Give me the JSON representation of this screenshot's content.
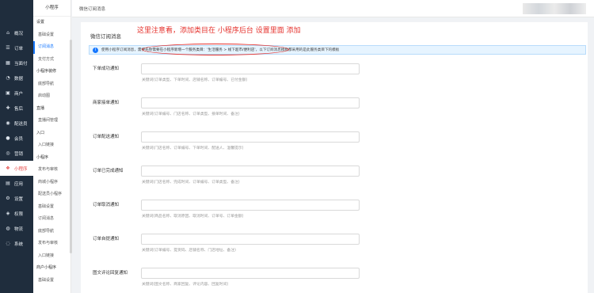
{
  "nav": {
    "items": [
      {
        "label": "概况",
        "icon": "home-icon"
      },
      {
        "label": "订单",
        "icon": "list-icon"
      },
      {
        "label": "当面付",
        "icon": "qr-icon"
      },
      {
        "label": "数据",
        "icon": "chart-icon"
      },
      {
        "label": "商户",
        "icon": "store-icon"
      },
      {
        "label": "售后",
        "icon": "service-icon"
      },
      {
        "label": "配送员",
        "icon": "courier-icon"
      },
      {
        "label": "会员",
        "icon": "user-icon"
      },
      {
        "label": "营销",
        "icon": "marketing-icon"
      },
      {
        "label": "小程序",
        "icon": "app-icon"
      },
      {
        "label": "应用",
        "icon": "grid-icon"
      },
      {
        "label": "设置",
        "icon": "gear-icon"
      },
      {
        "label": "权限",
        "icon": "lock-icon"
      },
      {
        "label": "物流",
        "icon": "truck-icon"
      },
      {
        "label": "系统",
        "icon": "system-icon"
      }
    ],
    "active_index": 9
  },
  "submenu": {
    "title": "小程序",
    "items": [
      {
        "label": "设置",
        "group": true
      },
      {
        "label": "基础设置"
      },
      {
        "label": "订阅消息",
        "active": true
      },
      {
        "label": "支付方式"
      },
      {
        "label": "小程序装修",
        "group": true
      },
      {
        "label": "底部导航"
      },
      {
        "label": "启动图"
      },
      {
        "label": "直播",
        "group": true
      },
      {
        "label": "直播间管理"
      },
      {
        "label": "入口",
        "group": true
      },
      {
        "label": "入口链接"
      },
      {
        "label": "小程序",
        "group": true
      },
      {
        "label": "发布与审核"
      },
      {
        "label": "商城小程序"
      },
      {
        "label": "配送员小程序"
      },
      {
        "label": "基础设置"
      },
      {
        "label": "订阅消息"
      },
      {
        "label": "底部导航"
      },
      {
        "label": "发布与审核"
      },
      {
        "label": "入口链接"
      },
      {
        "label": "商户小程序",
        "group": true
      },
      {
        "label": "基础设置"
      }
    ]
  },
  "topbar": {
    "breadcrumb": "微信订阅消息"
  },
  "card": {
    "title": "微信订阅消息"
  },
  "annotation": "这里注意看，添加类目在 小程序后台 设置里面 添加",
  "notice": {
    "prefix": "使用小程序订阅消息",
    "highlight": "需要先你需要在小程序新增一个服务类目：'生活服务 > 线下超市/便利店'",
    "suffix": "以下订阅消息模板都采用的是此服务类目下的模板"
  },
  "rows": [
    {
      "label": "下单成功通知",
      "hint": "关键词(订单类型、下单时间、店铺名称、订单编号、已付金额)"
    },
    {
      "label": "商家接单通知",
      "hint": "关键词(订单编号、门店名称、订单类型、接单时间、备注)"
    },
    {
      "label": "订单配送通知",
      "hint": "关键词(门店名称、订单编号、下单时间、配送人、温馨提示)"
    },
    {
      "label": "订单已完成通知",
      "hint": "关键词(门店名称、完成时间、订单编号、订单类型、备注)"
    },
    {
      "label": "订单取消通知",
      "hint": "关键词(商品名称、取消原因、取消时间、订单号、订单金额)"
    },
    {
      "label": "订单自提通知",
      "hint": "关键词(订单编号、提货码、店铺名称、门店地址、备注)"
    },
    {
      "label": "图文评论回复通知",
      "hint": "关键词(图文名称、商家回复、评论内容、回复时间)"
    }
  ]
}
